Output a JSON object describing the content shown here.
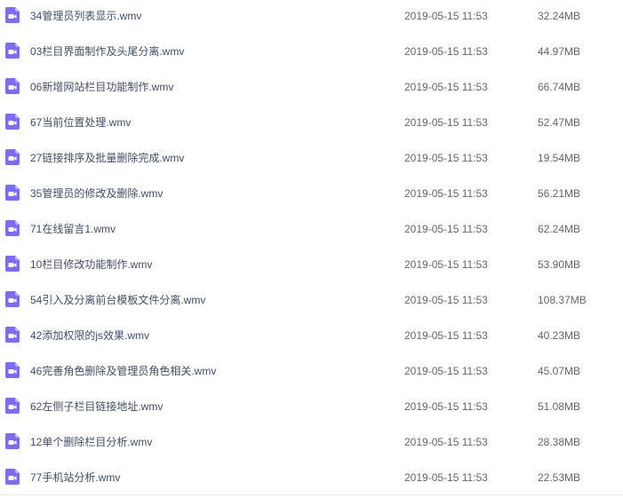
{
  "icon_colors": {
    "fill": "#7c6cf0",
    "fold": "#b8aefa",
    "glyph": "#ffffff"
  },
  "files": [
    {
      "name": "34管理员列表显示.wmv",
      "date": "2019-05-15 11:53",
      "size": "32.24MB",
      "icon": "video-file-icon"
    },
    {
      "name": "03栏目界面制作及头尾分离.wmv",
      "date": "2019-05-15 11:53",
      "size": "44.97MB",
      "icon": "video-file-icon"
    },
    {
      "name": "06新增网站栏目功能制作.wmv",
      "date": "2019-05-15 11:53",
      "size": "66.74MB",
      "icon": "video-file-icon"
    },
    {
      "name": "67当前位置处理.wmv",
      "date": "2019-05-15 11:53",
      "size": "52.47MB",
      "icon": "video-file-icon"
    },
    {
      "name": "27链接排序及批量删除完成.wmv",
      "date": "2019-05-15 11:53",
      "size": "19.54MB",
      "icon": "video-file-icon"
    },
    {
      "name": "35管理员的修改及删除.wmv",
      "date": "2019-05-15 11:53",
      "size": "56.21MB",
      "icon": "video-file-icon"
    },
    {
      "name": "71在线留言1.wmv",
      "date": "2019-05-15 11:53",
      "size": "62.24MB",
      "icon": "video-file-icon"
    },
    {
      "name": "10栏目修改功能制作.wmv",
      "date": "2019-05-15 11:53",
      "size": "53.90MB",
      "icon": "video-file-icon"
    },
    {
      "name": "54引入及分离前台模板文件分离.wmv",
      "date": "2019-05-15 11:53",
      "size": "108.37MB",
      "icon": "video-file-icon"
    },
    {
      "name": "42添加权限的js效果.wmv",
      "date": "2019-05-15 11:53",
      "size": "40.23MB",
      "icon": "video-file-icon"
    },
    {
      "name": "46完善角色删除及管理员角色相关.wmv",
      "date": "2019-05-15 11:53",
      "size": "45.07MB",
      "icon": "video-file-icon"
    },
    {
      "name": "62左侧子栏目链接地址.wmv",
      "date": "2019-05-15 11:53",
      "size": "51.08MB",
      "icon": "video-file-icon"
    },
    {
      "name": "12单个删除栏目分析.wmv",
      "date": "2019-05-15 11:53",
      "size": "28.38MB",
      "icon": "video-file-icon"
    },
    {
      "name": "77手机站分析.wmv",
      "date": "2019-05-15 11:53",
      "size": "22.53MB",
      "icon": "video-file-icon"
    }
  ]
}
